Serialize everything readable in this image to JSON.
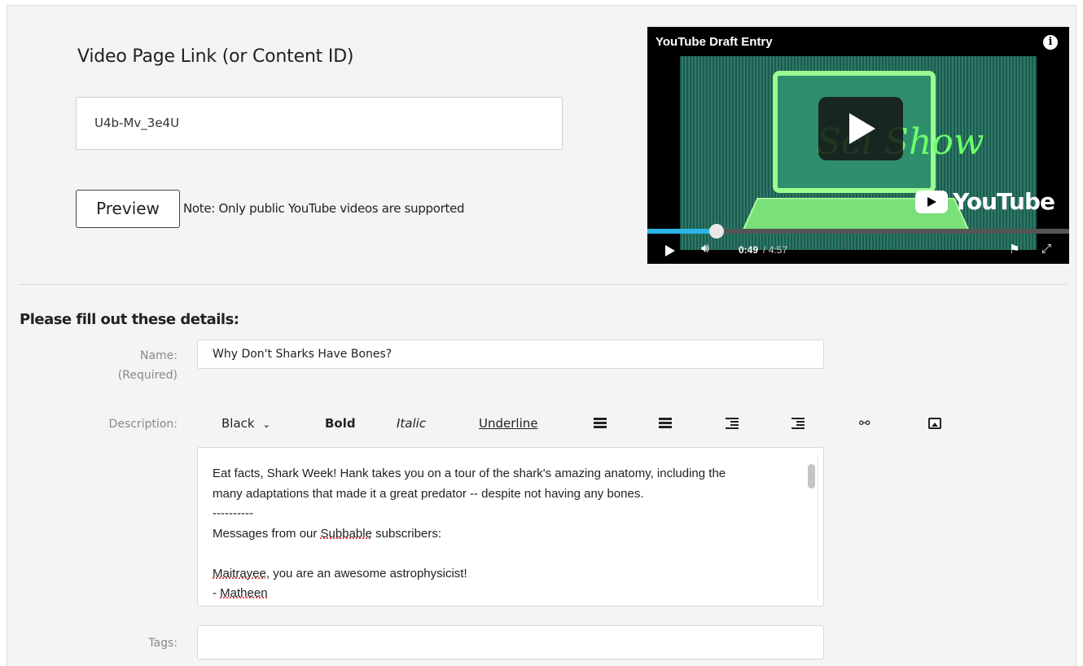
{
  "link_section": {
    "title": "Video Page Link (or Content ID)",
    "input_value": "U4b-Mv_3e4U",
    "preview_label": "Preview",
    "note": "Note: Only public YouTube videos are supported"
  },
  "player": {
    "title": "YouTube Draft Entry",
    "info_icon": "info-icon",
    "brand": "YouTube",
    "current_time": "0:49",
    "duration": "/ 4:57",
    "progress_fraction": 0.165,
    "progress_color": "#2bb6e6",
    "thumbnail_logo": "Sci Show",
    "icons": [
      "play-icon",
      "volume-icon",
      "flag-icon",
      "fullscreen-icon"
    ]
  },
  "details": {
    "heading": "Please fill out these details:",
    "name_label": "Name:",
    "name_required": "(Required)",
    "name_value": "Why Don't Sharks Have Bones?",
    "description_label": "Description:",
    "tags_label": "Tags:",
    "tags_value": ""
  },
  "toolbar": {
    "color_label": "Black",
    "color_chevron": "⌄",
    "bold_label": "Bold",
    "italic_label": "Italic",
    "underline_label": "Underline",
    "link_glyph": "⚯",
    "icons": [
      "bulleted-list-icon",
      "numbered-list-icon",
      "outdent-icon",
      "indent-icon",
      "link-icon",
      "image-icon"
    ]
  },
  "description": {
    "line1": "Eat facts, Shark Week! Hank takes you on a tour of the shark's amazing anatomy, including the",
    "line2": "many adaptations that made it a great predator -- despite not having any bones.",
    "line3": "----------",
    "line4_pre": "Messages from our ",
    "line4_word": "Subbable",
    "line4_post": " subscribers:",
    "line6_word": "Maitrayee",
    "line6_post": ", you are an awesome astrophysicist!",
    "line7_pre": "- ",
    "line7_word": "Matheen"
  }
}
